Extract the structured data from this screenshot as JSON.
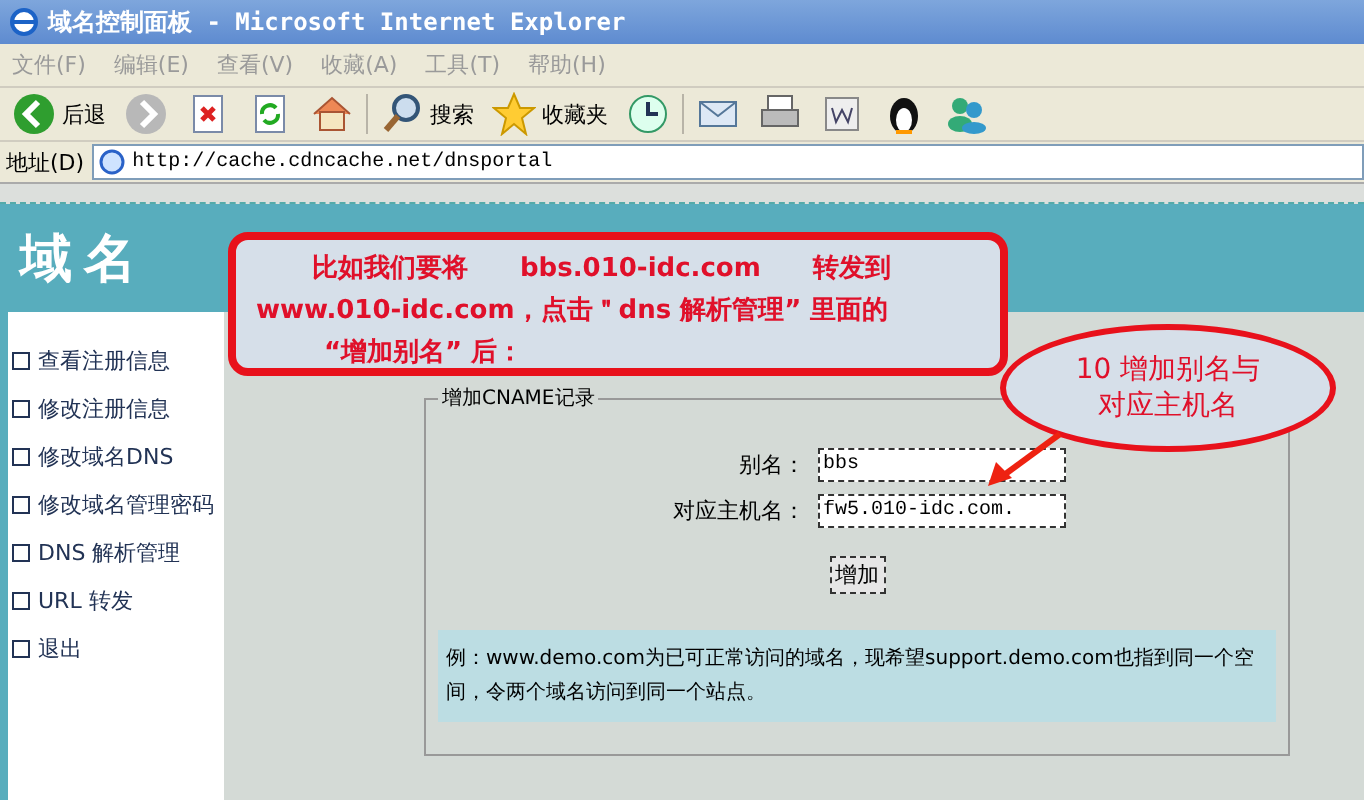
{
  "window": {
    "title": "域名控制面板 - Microsoft Internet Explorer"
  },
  "menu": [
    "文件(F)",
    "编辑(E)",
    "查看(V)",
    "收藏(A)",
    "工具(T)",
    "帮助(H)"
  ],
  "toolbar": [
    {
      "kind": "back",
      "label": "后退"
    },
    {
      "kind": "forward"
    },
    {
      "kind": "stop"
    },
    {
      "kind": "refresh"
    },
    {
      "kind": "home"
    },
    {
      "kind": "search",
      "label": "搜索"
    },
    {
      "kind": "favorites",
      "label": "收藏夹"
    },
    {
      "kind": "history"
    },
    {
      "kind": "mail"
    },
    {
      "kind": "print"
    },
    {
      "kind": "edit"
    },
    {
      "kind": "penguin"
    },
    {
      "kind": "people"
    }
  ],
  "address": {
    "label": "地址(D)",
    "url": "http://cache.cdncache.net/dnsportal"
  },
  "banner": {
    "title": "域名"
  },
  "sidebar": {
    "items": [
      "查看注册信息",
      "修改注册信息",
      "修改域名DNS",
      "修改域名管理密码",
      "DNS 解析管理",
      "URL 转发",
      "退出"
    ]
  },
  "callout": {
    "lines": [
      "比如我们要将　　**bbs.010-idc.com**　　转发到",
      "**www.010-idc.com**，点击＂dns 解析管理” 里面的",
      "“增加别名” 后："
    ]
  },
  "note": {
    "lines": [
      "10  增加别名与",
      "对应主机名"
    ]
  },
  "form": {
    "legend": "增加CNAME记录",
    "fields": [
      {
        "label": "别名：",
        "value": "bbs"
      },
      {
        "label": "对应主机名：",
        "value": "fw5.010-idc.com."
      }
    ],
    "button": "增加",
    "example": "例：www.demo.com为已可正常访问的域名，现希望support.demo.com也指到同一个空间，令两个域名访问到同一个站点。"
  }
}
